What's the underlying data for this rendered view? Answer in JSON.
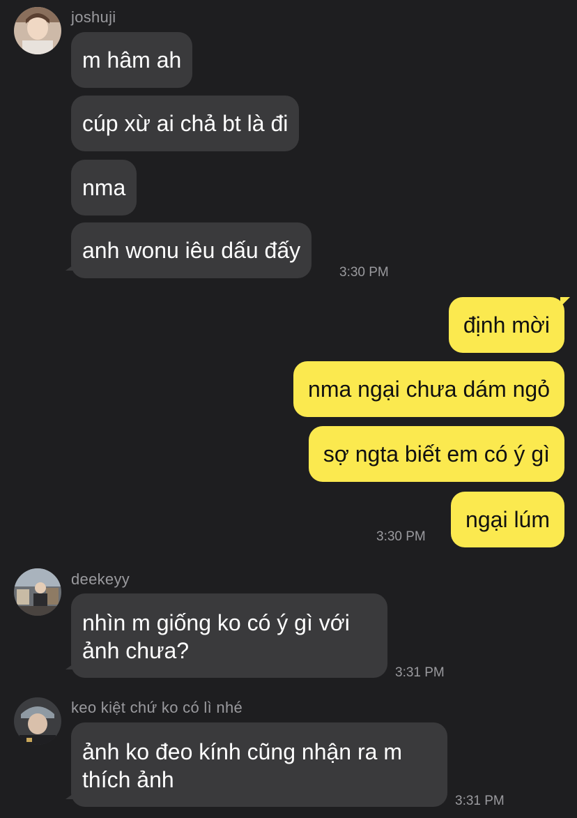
{
  "chat": {
    "groups": [
      {
        "sender": "joshuji",
        "messages": [
          "m hâm ah",
          "cúp xừ ai chả bt là đi",
          "nma",
          "anh wonu iêu dấu đấy"
        ],
        "time": "3:30 PM"
      },
      {
        "sender": "me",
        "messages": [
          "định mời",
          "nma ngại chưa dám ngỏ",
          "sợ ngta biết em có ý gì",
          "ngại lúm"
        ],
        "time": "3:30 PM"
      },
      {
        "sender": "deekeyy",
        "messages": [
          "nhìn m giống ko có ý gì với ảnh chưa?"
        ],
        "time": "3:31 PM"
      },
      {
        "sender": "keo kiệt chứ ko có lì nhé",
        "messages": [
          "ảnh ko đeo kính cũng nhận ra m thích ảnh"
        ],
        "time": "3:31 PM"
      }
    ]
  },
  "colors": {
    "background": "#1e1e20",
    "incoming_bubble": "#3a3a3c",
    "outgoing_bubble": "#fbe94f",
    "meta_text": "#9a9a9e"
  },
  "icons": {
    "avatar_1": "avatar-joshuji",
    "avatar_2": "avatar-deekeyy",
    "avatar_3": "avatar-keo"
  }
}
